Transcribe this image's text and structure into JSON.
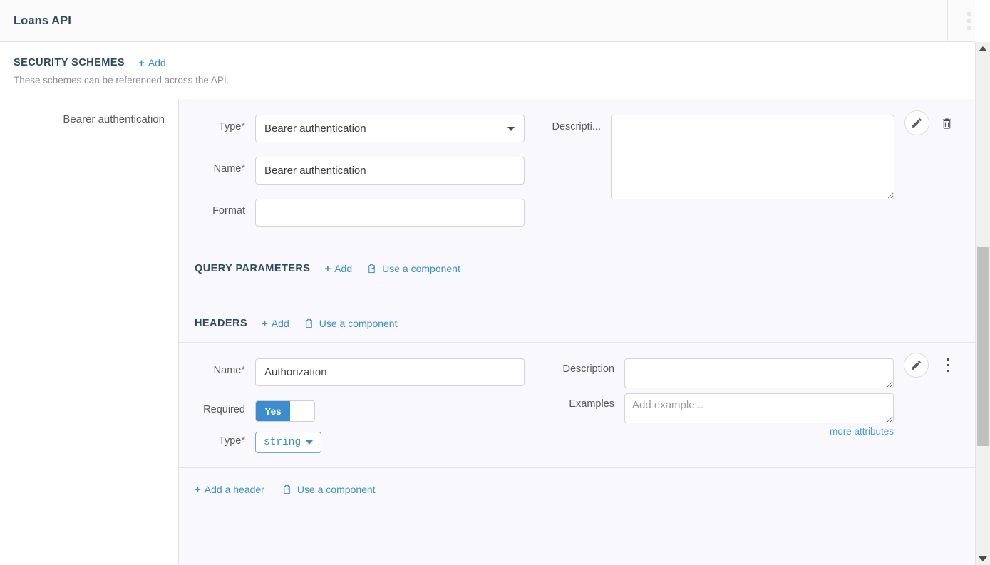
{
  "window": {
    "title": "Loans API",
    "overflow_menu_icon": "kebab-vertical-icon"
  },
  "security_schemes": {
    "heading": "SECURITY SCHEMES",
    "add_label": "Add",
    "description": "These schemes can be referenced across the API.",
    "list": [
      {
        "label": "Bearer authentication"
      }
    ],
    "form": {
      "type": {
        "label": "Type",
        "required_marker": "*",
        "value": "Bearer authentication",
        "caret_icon": "chevron-down-icon"
      },
      "name": {
        "label": "Name",
        "required_marker": "*",
        "value": "Bearer authentication",
        "placeholder": ""
      },
      "format": {
        "label": "Format",
        "value": "",
        "placeholder": ""
      },
      "description": {
        "label": "Descripti...",
        "value": "",
        "placeholder": ""
      },
      "edit_icon": "pencil-icon",
      "delete_icon": "trash-icon"
    }
  },
  "query_parameters": {
    "heading": "QUERY PARAMETERS",
    "add_label": "Add",
    "use_component_label": "Use a component",
    "component_icon": "clipboard-paste-icon"
  },
  "headers": {
    "heading": "HEADERS",
    "add_label": "Add",
    "use_component_label": "Use a component",
    "component_icon": "clipboard-paste-icon",
    "item": {
      "name": {
        "label": "Name",
        "required_marker": "*",
        "value": "Authorization",
        "placeholder": ""
      },
      "required": {
        "label": "Required",
        "value": "Yes"
      },
      "type": {
        "label": "Type",
        "required_marker": "*",
        "value": "string",
        "caret_icon": "chevron-down-icon"
      },
      "description": {
        "label": "Description",
        "value": "",
        "placeholder": ""
      },
      "examples": {
        "label": "Examples",
        "value": "",
        "placeholder": "Add example..."
      },
      "more_attributes_label": "more attributes",
      "edit_icon": "pencil-icon",
      "menu_icon": "kebab-vertical-icon"
    },
    "footer": {
      "add_header_label": "Add a header",
      "use_component_label": "Use a component"
    }
  },
  "scrollbar": {
    "up_icon": "triangle-up-icon",
    "down_icon": "triangle-down-icon"
  },
  "colors": {
    "accent_blue": "#3c8dcd",
    "heading_slate": "#2e4a5c",
    "panel_bg": "#f9f9fd",
    "toggle_on": "#3c8dcd"
  }
}
